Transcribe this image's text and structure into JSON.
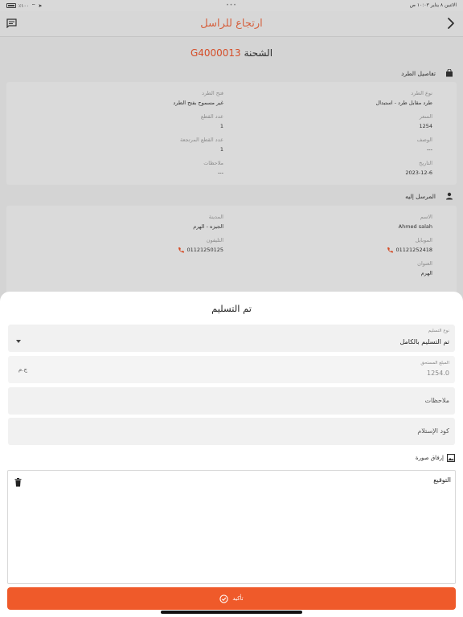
{
  "status_bar": {
    "time": "١٠:٠٣ ص",
    "date": "الاثنين ٨ يناير",
    "dots": "•••",
    "battery": "٪١٠٠"
  },
  "header": {
    "title": "ارتجاع للراسل"
  },
  "shipment": {
    "label": "الشحنة",
    "number": "G4000013"
  },
  "package_details": {
    "title": "تفاصيل الطرد",
    "fields": [
      {
        "key": "نوع الطرد",
        "value": "طرد مقابل طرد - استبدال"
      },
      {
        "key": "فتح الطرد",
        "value": "غير مسموح بفتح الطرد"
      },
      {
        "key": "السعر",
        "value": "1254"
      },
      {
        "key": "عدد القطع",
        "value": "1"
      },
      {
        "key": "الوصف",
        "value": "---"
      },
      {
        "key": "عدد القطع المرتجعة",
        "value": "1"
      },
      {
        "key": "التاريخ",
        "value": "2023-12-6"
      },
      {
        "key": "ملاحظات",
        "value": "---"
      }
    ]
  },
  "recipient": {
    "title": "المرسل إليه",
    "fields": [
      {
        "key": "الاسم",
        "value": "Ahmed salah"
      },
      {
        "key": "المدينة",
        "value": "الجيزه - الهرم"
      },
      {
        "key": "الموبايل",
        "value": "01121252418"
      },
      {
        "key": "التليفون",
        "value": "01121250125"
      },
      {
        "key": "العنوان",
        "value": "الهرم"
      }
    ]
  },
  "sheet": {
    "title": "تم التسليم",
    "delivery_type_label": "نوع التسليم",
    "delivery_type_value": "تم التسليم بالكامل",
    "amount_label": "المبلغ المستحق",
    "amount_value": "1254.0",
    "currency": "ج.م",
    "notes_placeholder": "ملاحظات",
    "code_placeholder": "كود الإستلام",
    "attach_label": "إرفاق صورة",
    "signature_label": "التوقيع",
    "confirm_label": "تأكيد"
  },
  "colors": {
    "accent": "#ef5a2a",
    "header_title": "#e86a45"
  }
}
